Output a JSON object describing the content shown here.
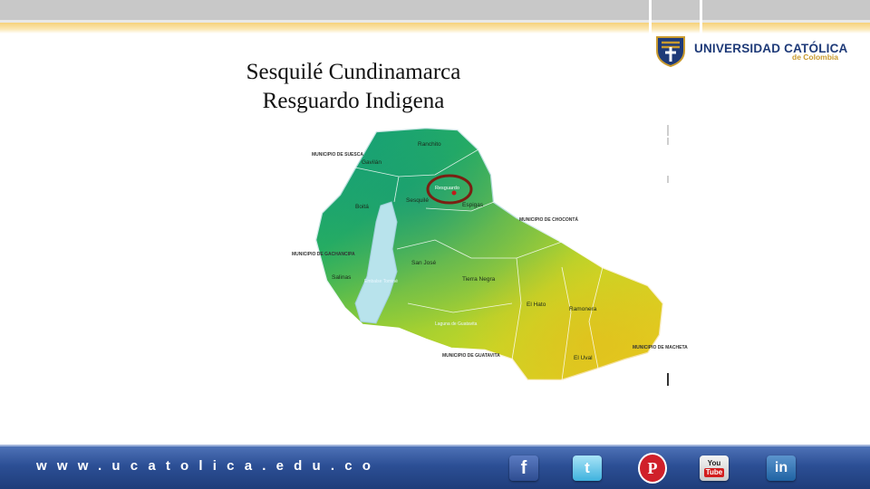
{
  "header": {
    "logo": {
      "name": "UNIVERSIDAD CATÓLICA",
      "sub": "de Colombia"
    }
  },
  "title": {
    "line1": "Sesquilé Cundinamarca",
    "line2": "Resguardo Indigena"
  },
  "map": {
    "neighbors": {
      "suesca": "MUNICIPIO DE SUESCA",
      "chocont": "MUNICIPIO DE CHOCONTÁ",
      "gachancipa": "MUNICIPIO DE GACHANCIPA",
      "machet": "MUNICIPIO DE MACHETA",
      "guatavita": "MUNICIPIO DE GUATAVITA"
    },
    "veredas": [
      "Ranchito",
      "Gavilán",
      "Boitá",
      "Sesquilé",
      "San José",
      "Salinas",
      "Tierra Negra",
      "El Hato",
      "Ramonera",
      "El Uval",
      "Espigas",
      "Resguardo"
    ],
    "water": {
      "reservoir": "Embalse Tominé",
      "lagoon": "Laguna de Guatavita"
    },
    "colors": {
      "water": "#b8e3ec",
      "high": "#1aa86b",
      "mid": "#8fcf3a",
      "low": "#e8d021",
      "border": "#ffffff",
      "marker": "#7a1f12"
    }
  },
  "footer": {
    "url": "www.ucatolica.edu.co",
    "social": [
      {
        "name": "facebook",
        "glyph": "f"
      },
      {
        "name": "twitter",
        "glyph": "t"
      },
      {
        "name": "pinterest",
        "glyph": "P"
      },
      {
        "name": "youtube",
        "you": "You",
        "tube": "Tube"
      },
      {
        "name": "linkedin",
        "glyph": "in"
      }
    ]
  }
}
